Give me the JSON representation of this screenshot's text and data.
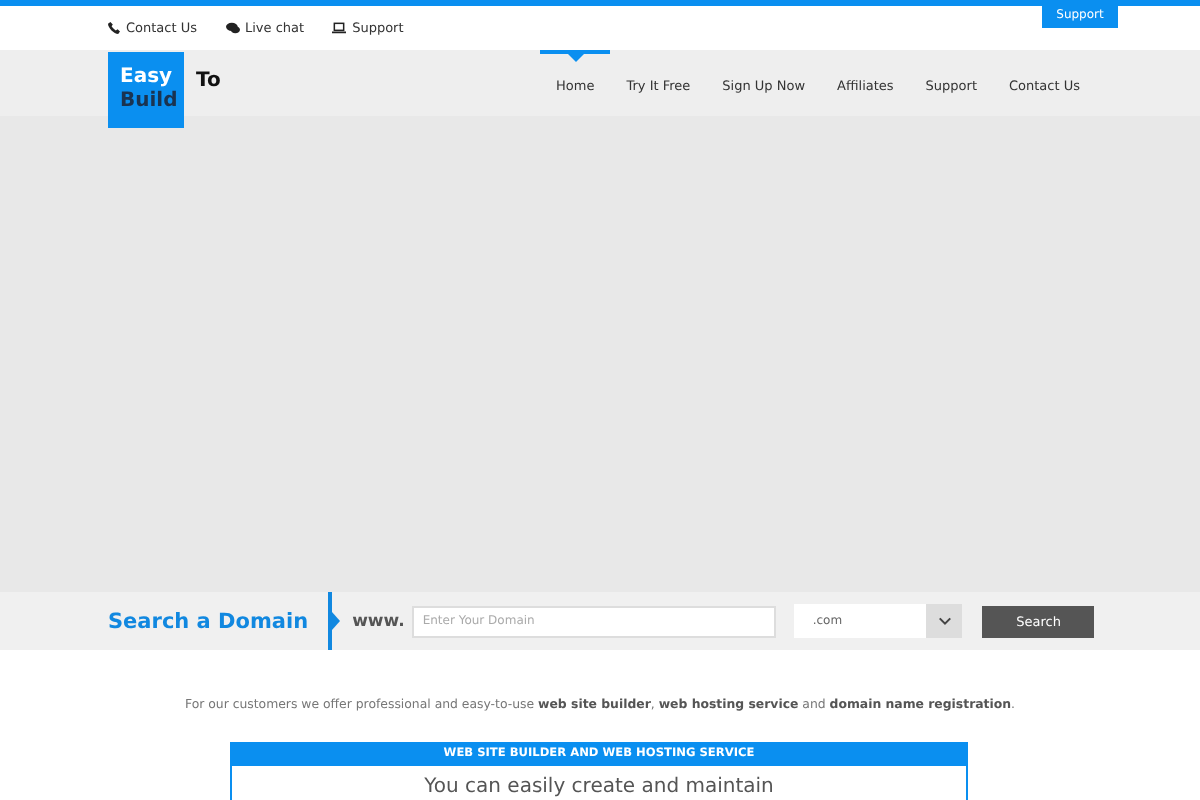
{
  "top_links": [
    "Contact Us",
    "Live chat",
    "Support"
  ],
  "support_button": "Support",
  "logo": {
    "first": "Easy",
    "second": "Build",
    "third": "To"
  },
  "nav": [
    {
      "label": "Home",
      "selected": true
    },
    {
      "label": "Try It Free",
      "selected": false
    },
    {
      "label": "Sign Up Now",
      "selected": false
    },
    {
      "label": "Affiliates",
      "selected": false
    },
    {
      "label": "Support",
      "selected": false
    },
    {
      "label": "Contact Us",
      "selected": false
    }
  ],
  "domain_search": {
    "title": "Search a Domain",
    "prefix": "www.",
    "placeholder": "Enter Your Domain",
    "extension": ".com",
    "button": "Search"
  },
  "intro": "For our customers we offer professional and easy-to-use **web site builder**, **web hosting service** and **domain name registration**.",
  "panel": {
    "title": "WEB SITE BUILDER AND WEB HOSTING SERVICE",
    "text": "You can easily create and maintain"
  }
}
